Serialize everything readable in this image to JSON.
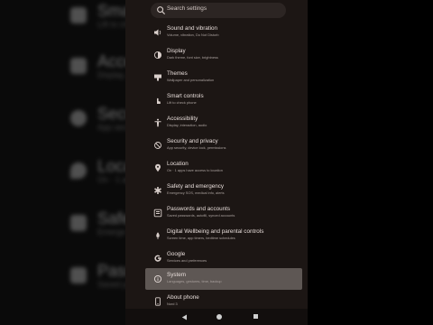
{
  "search": {
    "placeholder": "Search settings"
  },
  "settings": [
    {
      "title": "Sound and vibration",
      "subtitle": "Volume, vibration, Do Not Disturb",
      "icon": "speaker-icon"
    },
    {
      "title": "Display",
      "subtitle": "Dark theme, font size, brightness",
      "icon": "display-icon"
    },
    {
      "title": "Themes",
      "subtitle": "Wallpaper and personalization",
      "icon": "theme-icon"
    },
    {
      "title": "Smart controls",
      "subtitle": "Lift to check phone",
      "icon": "gesture-icon"
    },
    {
      "title": "Accessibility",
      "subtitle": "Display, interaction, audio",
      "icon": "accessibility-icon"
    },
    {
      "title": "Security and privacy",
      "subtitle": "App security, device lock, permissions",
      "icon": "security-icon"
    },
    {
      "title": "Location",
      "subtitle": "On · 1 apps have access to location",
      "icon": "location-icon"
    },
    {
      "title": "Safety and emergency",
      "subtitle": "Emergency SOS, medical info, alerts",
      "icon": "emergency-icon"
    },
    {
      "title": "Passwords and accounts",
      "subtitle": "Saved passwords, autofill, synced accounts",
      "icon": "accounts-icon"
    },
    {
      "title": "Digital Wellbeing and parental controls",
      "subtitle": "Screen time, app timers, bedtime schedules",
      "icon": "wellbeing-icon"
    },
    {
      "title": "Google",
      "subtitle": "Services and preferences",
      "icon": "google-icon"
    },
    {
      "title": "System",
      "subtitle": "Languages, gestures, time, backup",
      "icon": "info-icon"
    },
    {
      "title": "About phone",
      "subtitle": "Nord 3",
      "icon": "phone-icon"
    }
  ],
  "background": [
    {
      "title": "Smart",
      "subtitle": "Lift to check"
    },
    {
      "title": "Acces",
      "subtitle": "Display, intera"
    },
    {
      "title": "Secu",
      "subtitle": "App secu"
    },
    {
      "title": "Loca",
      "subtitle": "On · 1 ap"
    },
    {
      "title": "Safe",
      "subtitle": "Emerge"
    },
    {
      "title": "Pass",
      "subtitle": "Saved pas"
    }
  ],
  "colors": {
    "background": "#1c1614",
    "highlight": "#5e5754",
    "text": "#e8dedb",
    "subtext": "#a9a09d"
  }
}
